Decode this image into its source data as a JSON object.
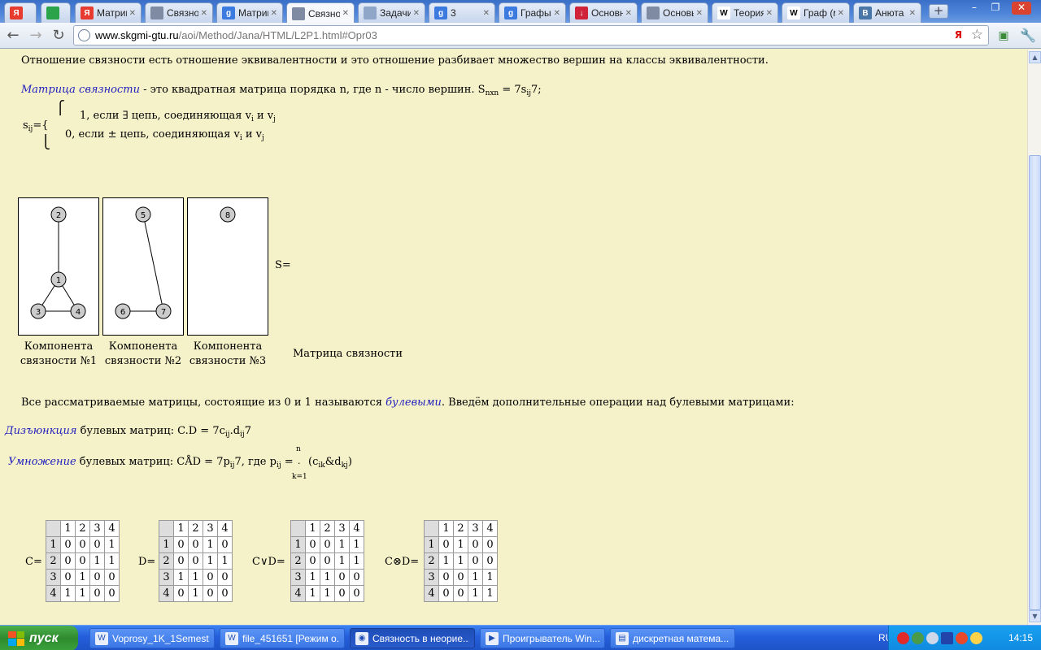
{
  "browser": {
    "tabs": [
      {
        "title": "",
        "icon_label": "Я",
        "icon_color": "#e63b2e"
      },
      {
        "title": "",
        "icon_label": "",
        "icon_color": "#2aa34a"
      },
      {
        "title": "Матриц",
        "icon_label": "Я",
        "icon_color": "#e63b2e"
      },
      {
        "title": "Связнос",
        "icon_label": "",
        "icon_color": "#7f8aa3"
      },
      {
        "title": "Матриц",
        "icon_label": "g",
        "icon_color": "#3b7be0"
      },
      {
        "title": "Связнос",
        "icon_label": "",
        "icon_color": "#7f8aa3"
      },
      {
        "title": "Задачи",
        "icon_label": "",
        "icon_color": "#8fa6c9"
      },
      {
        "title": "3",
        "icon_label": "g",
        "icon_color": "#3b7be0"
      },
      {
        "title": "Графы",
        "icon_label": "g",
        "icon_color": "#3b7be0"
      },
      {
        "title": "Основн",
        "icon_label": "↓",
        "icon_color": "#d0233a"
      },
      {
        "title": "Основы",
        "icon_label": "",
        "icon_color": "#7f8aa3"
      },
      {
        "title": "Теория",
        "icon_label": "W",
        "icon_color": "#ffffff"
      },
      {
        "title": "Граф (м",
        "icon_label": "W",
        "icon_color": "#ffffff"
      },
      {
        "title": "Анюта",
        "icon_label": "В",
        "icon_color": "#4a76a8"
      }
    ],
    "new_tab": "+",
    "url_host": "www.skgmi-gtu.ru",
    "url_path": "/aoi/Method/Jana/HTML/L2P1.html#Opr03",
    "url_badge": "Я"
  },
  "content": {
    "intro": "Отношение связности есть отношение эквивалентности и это отношение разбивает множество вершин на классы эквивалентности.",
    "matrix_term": "Матрица связности",
    "matrix_def_rest": " - это квадратная матрица порядка n, где n - число вершин. S",
    "matrix_def_sub": "nxn",
    "matrix_def_eq": " = 7s",
    "matrix_def_sub2": "ij",
    "matrix_def_end": "7;",
    "sij_label": "s",
    "sij_sub": "ij",
    "sij_eq": "={",
    "case1_a": "1, если ∃ цепь, соединяющая v",
    "case1_sub1": "i",
    "case1_mid": " и v",
    "case1_sub2": "j",
    "case2_a": "0, если ± цепь, соединяющая v",
    "case2_sub1": "i",
    "case2_mid": " и v",
    "case2_sub2": "j",
    "bracket_top": "⎧",
    "bracket_bottom": "⎩",
    "s_equals": "S=",
    "captions": [
      {
        "line1": "Компонента",
        "line2": "связности №1"
      },
      {
        "line1": "Компонента",
        "line2": "связности №2"
      },
      {
        "line1": "Компонента",
        "line2": "связности №3"
      }
    ],
    "matrix_caption": "Матрица связности",
    "bool_intro_a": "Все рассматриваемые матрицы, состоящие из 0 и 1 называются ",
    "bool_term": "булевыми",
    "bool_intro_b": ". Введём дополнительные операции над булевыми матрицами:",
    "disj_term": "Дизъюнкция",
    "disj_rest": " булевых матриц: C.D = 7c",
    "disj_sub1": "ij",
    "disj_dot": ".d",
    "disj_sub2": "ij",
    "disj_end": "7",
    "mult_term": "Умножение",
    "mult_rest": " булевых матриц: CÅD = 7p",
    "mult_sub1": "ij",
    "mult_mid": "7, где p",
    "mult_sub2": "ij",
    "mult_eq": " = ",
    "sum_top": "n",
    "sum_mid": ".",
    "sum_bottom": "k=1",
    "mult_tail_a": "(c",
    "mult_tail_sub1": "ik",
    "mult_tail_b": "&d",
    "mult_tail_sub2": "kj",
    "mult_tail_c": ")"
  },
  "graphs": [
    {
      "nodes": [
        "2",
        "1",
        "3",
        "4"
      ]
    },
    {
      "nodes": [
        "5",
        "6",
        "7"
      ]
    },
    {
      "nodes": [
        "8"
      ]
    }
  ],
  "matrices": [
    {
      "label": "C=",
      "header": [
        "1",
        "2",
        "3",
        "4"
      ],
      "rows": [
        [
          "1",
          "0",
          "0",
          "0",
          "1"
        ],
        [
          "2",
          "0",
          "0",
          "1",
          "1"
        ],
        [
          "3",
          "0",
          "1",
          "0",
          "0"
        ],
        [
          "4",
          "1",
          "1",
          "0",
          "0"
        ]
      ]
    },
    {
      "label": "D=",
      "header": [
        "1",
        "2",
        "3",
        "4"
      ],
      "rows": [
        [
          "1",
          "0",
          "0",
          "1",
          "0"
        ],
        [
          "2",
          "0",
          "0",
          "1",
          "1"
        ],
        [
          "3",
          "1",
          "1",
          "0",
          "0"
        ],
        [
          "4",
          "0",
          "1",
          "0",
          "0"
        ]
      ]
    },
    {
      "label": "C∨D=",
      "header": [
        "1",
        "2",
        "3",
        "4"
      ],
      "rows": [
        [
          "1",
          "0",
          "0",
          "1",
          "1"
        ],
        [
          "2",
          "0",
          "0",
          "1",
          "1"
        ],
        [
          "3",
          "1",
          "1",
          "0",
          "0"
        ],
        [
          "4",
          "1",
          "1",
          "0",
          "0"
        ]
      ]
    },
    {
      "label": "C⊗D=",
      "header": [
        "1",
        "2",
        "3",
        "4"
      ],
      "rows": [
        [
          "1",
          "0",
          "1",
          "0",
          "0"
        ],
        [
          "2",
          "1",
          "1",
          "0",
          "0"
        ],
        [
          "3",
          "0",
          "0",
          "1",
          "1"
        ],
        [
          "4",
          "0",
          "0",
          "1",
          "1"
        ]
      ]
    }
  ],
  "taskbar": {
    "start_label": "пуск",
    "tasks": [
      {
        "label": "Voprosy_1K_1Semest..."
      },
      {
        "label": "file_451651 [Режим о..."
      },
      {
        "label": "Связность в неорие..."
      },
      {
        "label": "Проигрыватель Win..."
      },
      {
        "label": "дискретная матема..."
      }
    ],
    "lang": "RU",
    "clock": "14:15"
  }
}
